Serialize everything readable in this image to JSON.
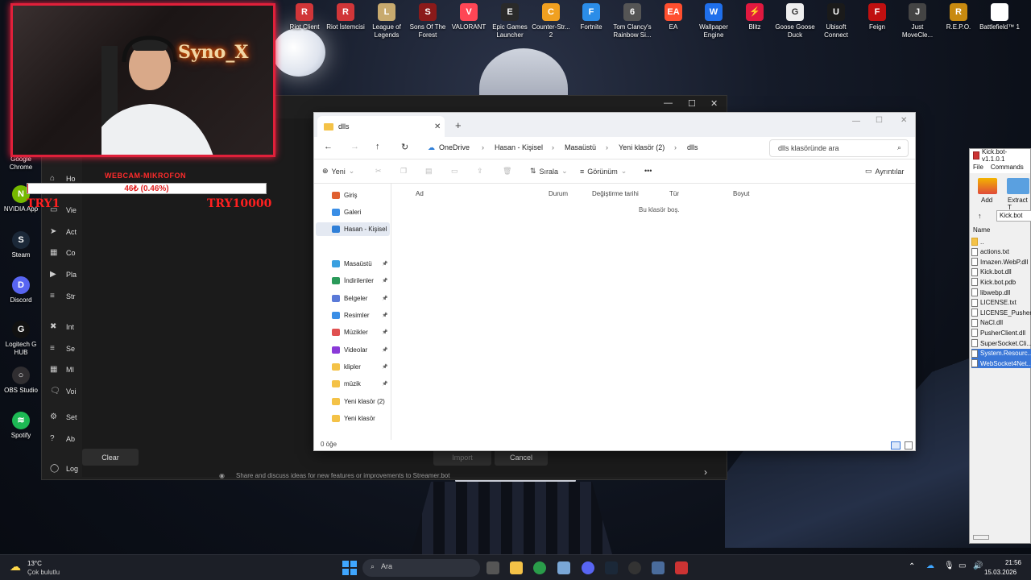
{
  "desktop_top_icons": [
    {
      "label": "Riot Client",
      "color": "#d13639",
      "glyph": "R"
    },
    {
      "label": "Riot İstemcisi",
      "color": "#d13639",
      "glyph": "R"
    },
    {
      "label": "League of Legends",
      "color": "#c8aa6e",
      "glyph": "L"
    },
    {
      "label": "Sons Of The Forest",
      "color": "#8b1a1a",
      "glyph": "S"
    },
    {
      "label": "VALORANT",
      "color": "#ff4655",
      "glyph": "V"
    },
    {
      "label": "Epic Games Launcher",
      "color": "#2a2a2a",
      "glyph": "E"
    },
    {
      "label": "Counter-Str... 2",
      "color": "#f0a020",
      "glyph": "C"
    },
    {
      "label": "Fortnite",
      "color": "#2b8de8",
      "glyph": "F"
    },
    {
      "label": "Tom Clancy's Rainbow Si...",
      "color": "#555555",
      "glyph": "6"
    },
    {
      "label": "EA",
      "color": "#ff4f2f",
      "glyph": "EA"
    },
    {
      "label": "Wallpaper Engine",
      "color": "#1f6feb",
      "glyph": "W"
    },
    {
      "label": "Blitz",
      "color": "#e0193f",
      "glyph": "⚡"
    },
    {
      "label": "Goose Goose Duck",
      "color": "#eeeeee",
      "glyph": "G"
    },
    {
      "label": "Ubisoft Connect",
      "color": "#1a1a1a",
      "glyph": "U"
    },
    {
      "label": "Feign",
      "color": "#c01010",
      "glyph": "F"
    },
    {
      "label": "Just MoveCle...",
      "color": "#444444",
      "glyph": "J"
    },
    {
      "label": "R.E.P.O.",
      "color": "#c88a10",
      "glyph": "R"
    },
    {
      "label": "Battlefield™ 1",
      "color": "#ffffff",
      "glyph": ""
    }
  ],
  "desktop_left_icons": [
    {
      "label": "Google Chrome",
      "color": "#2a9d4a",
      "glyph": "●"
    },
    {
      "label": "NVIDIA App",
      "color": "#76b900",
      "glyph": "N"
    },
    {
      "label": "Steam",
      "color": "#1b2838",
      "glyph": "S"
    },
    {
      "label": "Discord",
      "color": "#5865f2",
      "glyph": "D"
    },
    {
      "label": "Logitech G HUB",
      "color": "#111111",
      "glyph": "G"
    },
    {
      "label": "OBS Studio",
      "color": "#302e31",
      "glyph": "○"
    },
    {
      "label": "Spotify",
      "color": "#1db954",
      "glyph": "≋"
    }
  ],
  "webcam": {
    "neon_text": "Syno_X",
    "title": "WEBCAM-MIKROFON",
    "bar_text": "46₺ (0.46%)",
    "bar_fraction": 0.0046,
    "left_label": "TRY1",
    "right_label": "TRY10000"
  },
  "streamerbot": {
    "menu": [
      {
        "label": "Ho",
        "icon": "⌂"
      },
      {
        "label": "Vie",
        "icon": "▭"
      },
      {
        "label": "Act",
        "icon": "➤"
      },
      {
        "label": "Co",
        "icon": "▦"
      },
      {
        "label": "Pla",
        "icon": "▶"
      },
      {
        "label": "Str",
        "icon": "≡"
      },
      {
        "label": "Int",
        "icon": "✖"
      },
      {
        "label": "Se",
        "icon": "≡"
      },
      {
        "label": "MI",
        "icon": "▦"
      },
      {
        "label": "Voi",
        "icon": "🗨"
      },
      {
        "label": "Set",
        "icon": "⚙"
      },
      {
        "label": "Ab",
        "icon": "?"
      },
      {
        "label": "Log",
        "icon": "◯"
      }
    ],
    "clear_label": "Clear",
    "import_label": "Import",
    "cancel_label": "Cancel",
    "footer_text": "Share and discuss ideas for new features or improvements to Streamer.bot"
  },
  "explorer": {
    "tab_title": "dlls",
    "breadcrumbs": [
      "OneDrive",
      "Hasan - Kişisel",
      "Masaüstü",
      "Yeni klasör (2)",
      "dlls"
    ],
    "search_placeholder": "dlls klasöründe ara",
    "toolbar": {
      "new": "Yeni",
      "sort": "Sırala",
      "view": "Görünüm",
      "more": "•••",
      "details": "Ayrıntılar"
    },
    "nav": [
      {
        "label": "Giriş",
        "color": "#e06030",
        "pinned": false
      },
      {
        "label": "Galeri",
        "color": "#3a8ee6",
        "pinned": false
      },
      {
        "label": "Hasan - Kişisel",
        "color": "#2f7fd8",
        "pinned": false,
        "selected": true
      },
      {
        "label": "Masaüstü",
        "color": "#3aa0e0",
        "pinned": true
      },
      {
        "label": "İndirilenler",
        "color": "#2a9a5a",
        "pinned": true
      },
      {
        "label": "Belgeler",
        "color": "#5a7ad8",
        "pinned": true
      },
      {
        "label": "Resimler",
        "color": "#3a8ee6",
        "pinned": true
      },
      {
        "label": "Müzikler",
        "color": "#e05050",
        "pinned": true
      },
      {
        "label": "Videolar",
        "color": "#8a3ad8",
        "pinned": true
      },
      {
        "label": "klipler",
        "color": "#f4c247",
        "pinned": true
      },
      {
        "label": "müzik",
        "color": "#f4c247",
        "pinned": true
      },
      {
        "label": "Yeni klasör (2)",
        "color": "#f4c247",
        "pinned": false
      },
      {
        "label": "Yeni klasör",
        "color": "#f4c247",
        "pinned": false
      }
    ],
    "columns": [
      "Ad",
      "Durum",
      "Değiştirme tarihi",
      "Tür",
      "Boyut"
    ],
    "empty_message": "Bu klasör boş.",
    "status": "0 öğe"
  },
  "kickbot": {
    "title": "Kick.bot-v1.1.0.1",
    "menu": [
      "File",
      "Commands"
    ],
    "buttons": [
      "Add",
      "Extract T"
    ],
    "path": "Kick.bot",
    "column": "Name",
    "files": [
      {
        "name": "..",
        "type": "folder",
        "selected": false
      },
      {
        "name": "actions.txt",
        "type": "file",
        "selected": false
      },
      {
        "name": "Imazen.WebP.dll",
        "type": "file",
        "selected": false
      },
      {
        "name": "Kick.bot.dll",
        "type": "file",
        "selected": false
      },
      {
        "name": "Kick.bot.pdb",
        "type": "file",
        "selected": false
      },
      {
        "name": "libwebp.dll",
        "type": "file",
        "selected": false
      },
      {
        "name": "LICENSE.txt",
        "type": "file",
        "selected": false
      },
      {
        "name": "LICENSE_Pusher...",
        "type": "file",
        "selected": false
      },
      {
        "name": "NaCl.dll",
        "type": "file",
        "selected": false
      },
      {
        "name": "PusherClient.dll",
        "type": "file",
        "selected": false
      },
      {
        "name": "SuperSocket.Cli...",
        "type": "file",
        "selected": false
      },
      {
        "name": "System.Resourc...",
        "type": "file",
        "selected": true
      },
      {
        "name": "WebSocket4Net...",
        "type": "file",
        "selected": true
      }
    ]
  },
  "taskbar": {
    "weather_temp": "13°C",
    "weather_desc": "Çok bulutlu",
    "search_placeholder": "Ara",
    "time": "21:56",
    "date": "15.03.2026"
  }
}
